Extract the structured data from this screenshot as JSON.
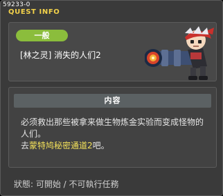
{
  "header": {
    "quest_id": "59233-0",
    "title": "QUEST INFO"
  },
  "quest": {
    "category_tag": "一般",
    "name": "[林之灵] 消失的人们2"
  },
  "content": {
    "heading": "内容",
    "line1": "必须救出那些被拿来做生物炼金实验而变成怪物的人们。",
    "line2_prefix": "去",
    "line2_highlight": "蒙特鸠秘密通道2",
    "line2_suffix": "吧。"
  },
  "footer": {
    "status": "狀態: 可開始 / 不可執行任務"
  },
  "colors": {
    "title": "#f3d24a",
    "tag": "#8bbd3c",
    "highlight": "#f3e15a"
  },
  "icons": {
    "npc": "npc-character-icon"
  }
}
